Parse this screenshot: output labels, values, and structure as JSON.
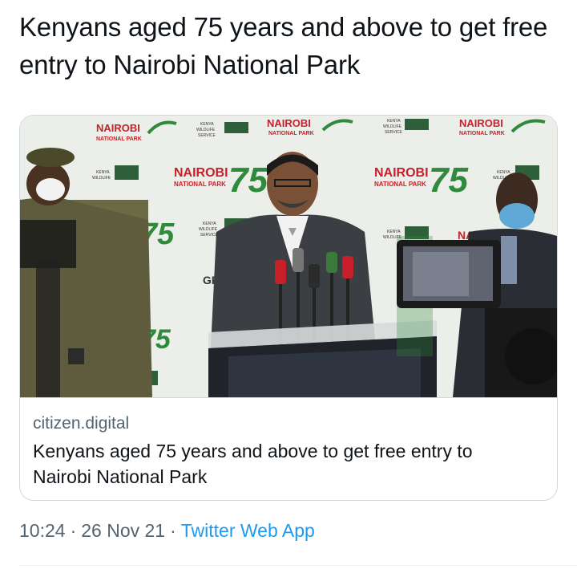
{
  "tweet": {
    "text": "Kenyans aged 75 years and above to get free entry to Nairobi National Park"
  },
  "card": {
    "domain": "citizen.digital",
    "title": "Kenyans aged 75 years and above to get free entry to Nairobi National Park",
    "image": {
      "backdrop_logo": {
        "line1": "NAIROBI",
        "line2": "NATIONAL PARK",
        "number": "75"
      },
      "kws_logo": {
        "line1": "KENYA",
        "line2": "WILDLIFE",
        "line3": "SERVICE"
      },
      "colors": {
        "red": "#c8202a",
        "green": "#2f8a3c",
        "suit": "#3b3e42",
        "uniform": "#6c6a45"
      }
    }
  },
  "meta": {
    "time": "10:24",
    "separator": "·",
    "date": "26 Nov 21",
    "source": "Twitter Web App"
  }
}
